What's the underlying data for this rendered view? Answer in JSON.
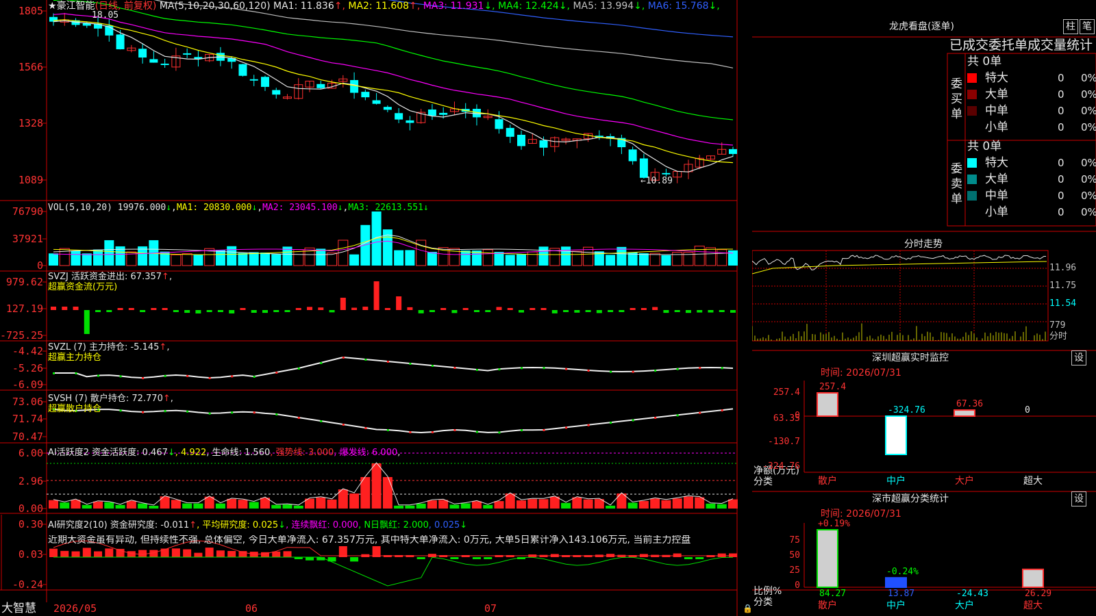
{
  "stock": {
    "star": "★",
    "name": "豪江智能",
    "mode": "(日线, 前复权)"
  },
  "price_panel": {
    "y_ticks": [
      "1805",
      "1566",
      "1328",
      "1089"
    ],
    "ma_header": "MA(5,10,20,30,60,120)",
    "ma_values": [
      {
        "label": "MA1: 11.836",
        "arrow": "↑",
        "color": "#e8e8e8"
      },
      {
        "label": "MA2: 11.608",
        "arrow": "↑",
        "color": "#ffff00"
      },
      {
        "label": "MA3: 11.931",
        "arrow": "↓",
        "color": "#ff00ff"
      },
      {
        "label": "MA4: 12.424",
        "arrow": "↓",
        "color": "#00ff00"
      },
      {
        "label": "MA5: 13.994",
        "arrow": "↓",
        "color": "#c0c0c0"
      },
      {
        "label": "MA6: 15.768",
        "arrow": "↓",
        "color": "#3060ff"
      }
    ],
    "high_label": "18.05",
    "low_label": "10.89"
  },
  "vol_panel": {
    "y_ticks": [
      "76790",
      "37921",
      "0"
    ],
    "header": "VOL(5,10,20)",
    "value": "19976.000",
    "value_arrow": "↓",
    "ma1": "MA1: 20830.000",
    "ma1_arrow": "↓",
    "ma2": "MA2: 23045.100",
    "ma2_arrow": "↓",
    "ma3": "MA3: 22613.551",
    "ma3_arrow": "↓"
  },
  "svzj_panel": {
    "y_ticks": [
      "979.62",
      "127.19",
      "-725.25"
    ],
    "header": "SVZJ  活跃资金进出: 67.357",
    "arrow": "↑",
    "tail": ",",
    "subtitle": "超赢资金流(万元)"
  },
  "svzl_panel": {
    "y_ticks": [
      "-4.42",
      "-5.26",
      "-6.09"
    ],
    "header": "SVZL (7) 主力持仓: -5.145",
    "arrow": "↑",
    "tail": ",",
    "subtitle": "超赢主力持仓"
  },
  "svsh_panel": {
    "y_ticks": [
      "73.06",
      "71.74",
      "70.47"
    ],
    "header": "SVSH (7) 散户持仓: 72.770",
    "arrow": "↑",
    "tail": ",",
    "subtitle": "超赢散户持仓"
  },
  "ai_active_panel": {
    "y_ticks": [
      "6.00",
      "2.96",
      "0.00"
    ],
    "header": "AI活跃度2 资金活跃度: 0.467",
    "a1": "↓",
    "v2": ", 4.922",
    "v3": ", 生命线: 1.560",
    "v4": ", 强势线: 3.000",
    "v5": ", 爆发线: 6.000",
    "tail": ","
  },
  "ai_research_panel": {
    "y_ticks": [
      "0.30",
      "0.03",
      "-0.24"
    ],
    "header": "AI研究度2(10) 资金研究度: -0.011",
    "a1": "↑",
    "v2": ", 平均研究度: 0.025",
    "a2": "↓",
    "v3": ", 连续飘红: 0.000",
    "v4": ", N日飘红: 2.000",
    "v5": ", 0.025",
    "a5": "↓",
    "comment": "近期大资金虽有异动, 但持续性不强, 总体偏空, 今日大单净流入: 67.357万元, 其中特大单净流入: 0万元, 大单5日累计净入143.106万元, 当前主力控盘"
  },
  "bottom": {
    "brand": "大智慧",
    "dates": [
      "2026/05",
      "06",
      "07"
    ]
  },
  "dragon_panel": {
    "title": "龙虎看盘(逐单)",
    "btn_zhu": "柱",
    "btn_bi": "笔",
    "heading": "已成交委托单成交量统计",
    "buy_label": "委买单",
    "sell_label": "委卖单",
    "buy_total": "共 0单",
    "sell_total": "共 0单",
    "buy_rows": [
      {
        "name": "特大",
        "count": "0",
        "pct": "0%",
        "color": "#ff0000"
      },
      {
        "name": "大单",
        "count": "0",
        "pct": "0%",
        "color": "#8b0000"
      },
      {
        "name": "中单",
        "count": "0",
        "pct": "0%",
        "color": "#5a0000"
      },
      {
        "name": "小单",
        "count": "0",
        "pct": "0%",
        "color": "#000000"
      }
    ],
    "sell_rows": [
      {
        "name": "特大",
        "count": "0",
        "pct": "0%",
        "color": "#00ffff"
      },
      {
        "name": "大单",
        "count": "0",
        "pct": "0%",
        "color": "#008b8b"
      },
      {
        "name": "中单",
        "count": "0",
        "pct": "0%",
        "color": "#007070"
      },
      {
        "name": "小单",
        "count": "0",
        "pct": "0%",
        "color": "#000000"
      }
    ]
  },
  "intraday_panel": {
    "title": "分时走势",
    "price_ticks": [
      "11.96",
      "11.75",
      "11.54"
    ],
    "vol_tick": "779",
    "vol_label": "分时"
  },
  "sz_monitor": {
    "title": "深圳超赢实时监控",
    "btn": "设",
    "time": "时间: 2026/07/31",
    "y_ticks": [
      "257.4",
      "63.35",
      "0",
      "-130.7",
      "-324.76"
    ],
    "y_label1": "净额(万元)",
    "y_label2": "分类",
    "bars": [
      {
        "cat": "散户",
        "value": 257.4,
        "label": "257.4",
        "cat_color": "#ff3333",
        "label_color": "#ff3333"
      },
      {
        "cat": "中户",
        "value": -324.76,
        "label": "-324.76",
        "cat_color": "#00ffff",
        "label_color": "#00ffff"
      },
      {
        "cat": "大户",
        "value": 67.36,
        "label": "67.36",
        "cat_color": "#ff3333",
        "label_color": "#ff3333"
      },
      {
        "cat": "超大",
        "value": 0,
        "label": "0",
        "cat_color": "#e8e8e8",
        "label_color": "#e8e8e8"
      }
    ]
  },
  "sz_classify": {
    "title": "深市超赢分类统计",
    "btn": "设",
    "time": "时间: 2026/07/31",
    "y_ticks": [
      "75",
      "50",
      "25",
      "0"
    ],
    "y_label1": "比例%",
    "y_label2": "分类",
    "bars": [
      {
        "cat": "散户",
        "value": 84.27,
        "label": "84.27",
        "top_label": "+0.19%",
        "cat_color": "#ff3333",
        "label_color": "#00ff00",
        "top_color": "#ff3333"
      },
      {
        "cat": "中户",
        "value": 13.87,
        "label": "13.87",
        "top_label": "-0.24%",
        "cat_color": "#00ffff",
        "label_color": "#3060ff",
        "top_color": "#00ff00"
      },
      {
        "cat": "大户",
        "value": -24.43,
        "label": "-24.43",
        "top_label": "",
        "cat_color": "#00ffff",
        "label_color": "#00ffff",
        "top_color": "#e8e8e8"
      },
      {
        "cat": "超大",
        "value": 26.29,
        "label": "26.29",
        "top_label": "",
        "cat_color": "#ff3333",
        "label_color": "#ff3333",
        "top_color": "#e8e8e8"
      }
    ]
  }
}
